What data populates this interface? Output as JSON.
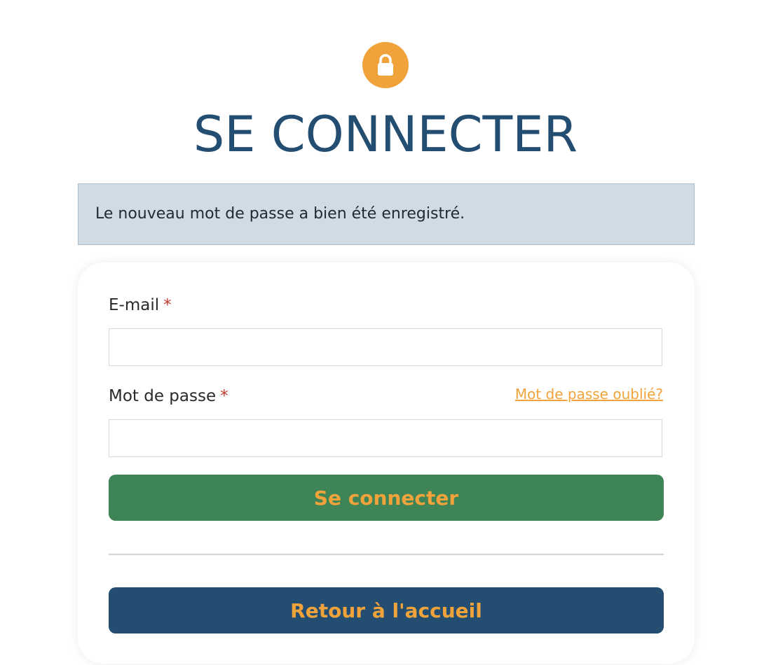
{
  "header": {
    "icon": "lock-icon",
    "title": "SE CONNECTER"
  },
  "alert": {
    "message": "Le nouveau mot de passe a bien été enregistré."
  },
  "form": {
    "email_label": "E-mail",
    "email_value": "",
    "password_label": "Mot de passe",
    "password_value": "",
    "required_marker": "*",
    "forgot_link": "Mot de passe oublié?",
    "submit_label": "Se connecter",
    "home_label": "Retour à l'accueil"
  },
  "colors": {
    "accent_orange": "#f0a33a",
    "title_blue": "#234e72",
    "submit_green": "#3f8456",
    "alert_bg": "#d0dbe3"
  }
}
